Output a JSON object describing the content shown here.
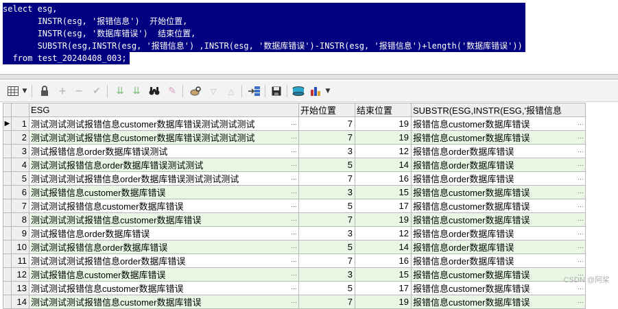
{
  "editor": {
    "lines": [
      "select esg,",
      "       INSTR(esg, '报错信息')  开始位置,",
      "       INSTR(esg, '数据库错误')  结束位置,",
      "       SUBSTR(esg,INSTR(esg, '报错信息') ,INSTR(esg, '数据库错误')-INSTR(esg, '报错信息')+length('数据库错误'))",
      "  from test_20240408_003;"
    ]
  },
  "toolbar": {
    "icons": [
      "grid-view-icon",
      "lock-icon",
      "add-record-icon",
      "delete-record-icon",
      "post-edit-icon",
      "filter-icon",
      "clear-filter-icon",
      "find-icon",
      "clear-icon",
      "query-by-example-icon",
      "sort-down-icon",
      "sort-up-icon",
      "export-icon",
      "save-icon",
      "connect-icon",
      "chart-icon"
    ]
  },
  "grid": {
    "columns": [
      "ESG",
      "开始位置",
      "结束位置",
      "SUBSTR(ESG,INSTR(ESG,'报错信息"
    ],
    "rows": [
      {
        "n": "1",
        "esg": "测试测试测试报错信息customer数据库错误测试测试测试",
        "start": "7",
        "end": "19",
        "sub": "报错信息customer数据库错误"
      },
      {
        "n": "2",
        "esg": "测试测试测试报错信息customer数据库错误测试测试测试",
        "start": "7",
        "end": "19",
        "sub": "报错信息customer数据库错误"
      },
      {
        "n": "3",
        "esg": "测试报错信息order数据库错误测试",
        "start": "3",
        "end": "12",
        "sub": "报错信息order数据库错误"
      },
      {
        "n": "4",
        "esg": "测试测试报错信息order数据库错误测试测试",
        "start": "5",
        "end": "14",
        "sub": "报错信息order数据库错误"
      },
      {
        "n": "5",
        "esg": "测试测试测试报错信息order数据库错误测试测试测试",
        "start": "7",
        "end": "16",
        "sub": "报错信息order数据库错误"
      },
      {
        "n": "6",
        "esg": "测试报错信息customer数据库错误",
        "start": "3",
        "end": "15",
        "sub": "报错信息customer数据库错误"
      },
      {
        "n": "7",
        "esg": "测试测试报错信息customer数据库错误",
        "start": "5",
        "end": "17",
        "sub": "报错信息customer数据库错误"
      },
      {
        "n": "8",
        "esg": "测试测试测试报错信息customer数据库错误",
        "start": "7",
        "end": "19",
        "sub": "报错信息customer数据库错误"
      },
      {
        "n": "9",
        "esg": "测试报错信息order数据库错误",
        "start": "3",
        "end": "12",
        "sub": "报错信息order数据库错误"
      },
      {
        "n": "10",
        "esg": "测试测试报错信息order数据库错误",
        "start": "5",
        "end": "14",
        "sub": "报错信息order数据库错误"
      },
      {
        "n": "11",
        "esg": "测试测试测试报错信息order数据库错误",
        "start": "7",
        "end": "16",
        "sub": "报错信息order数据库错误"
      },
      {
        "n": "12",
        "esg": "测试报错信息customer数据库错误",
        "start": "3",
        "end": "15",
        "sub": "报错信息customer数据库错误"
      },
      {
        "n": "13",
        "esg": "测试测试报错信息customer数据库错误",
        "start": "5",
        "end": "17",
        "sub": "报错信息customer数据库错误"
      },
      {
        "n": "14",
        "esg": "测试测试测试报错信息customer数据库错误",
        "start": "7",
        "end": "19",
        "sub": "报错信息customer数据库错误"
      }
    ]
  },
  "watermark": "CSDN @阿桨"
}
